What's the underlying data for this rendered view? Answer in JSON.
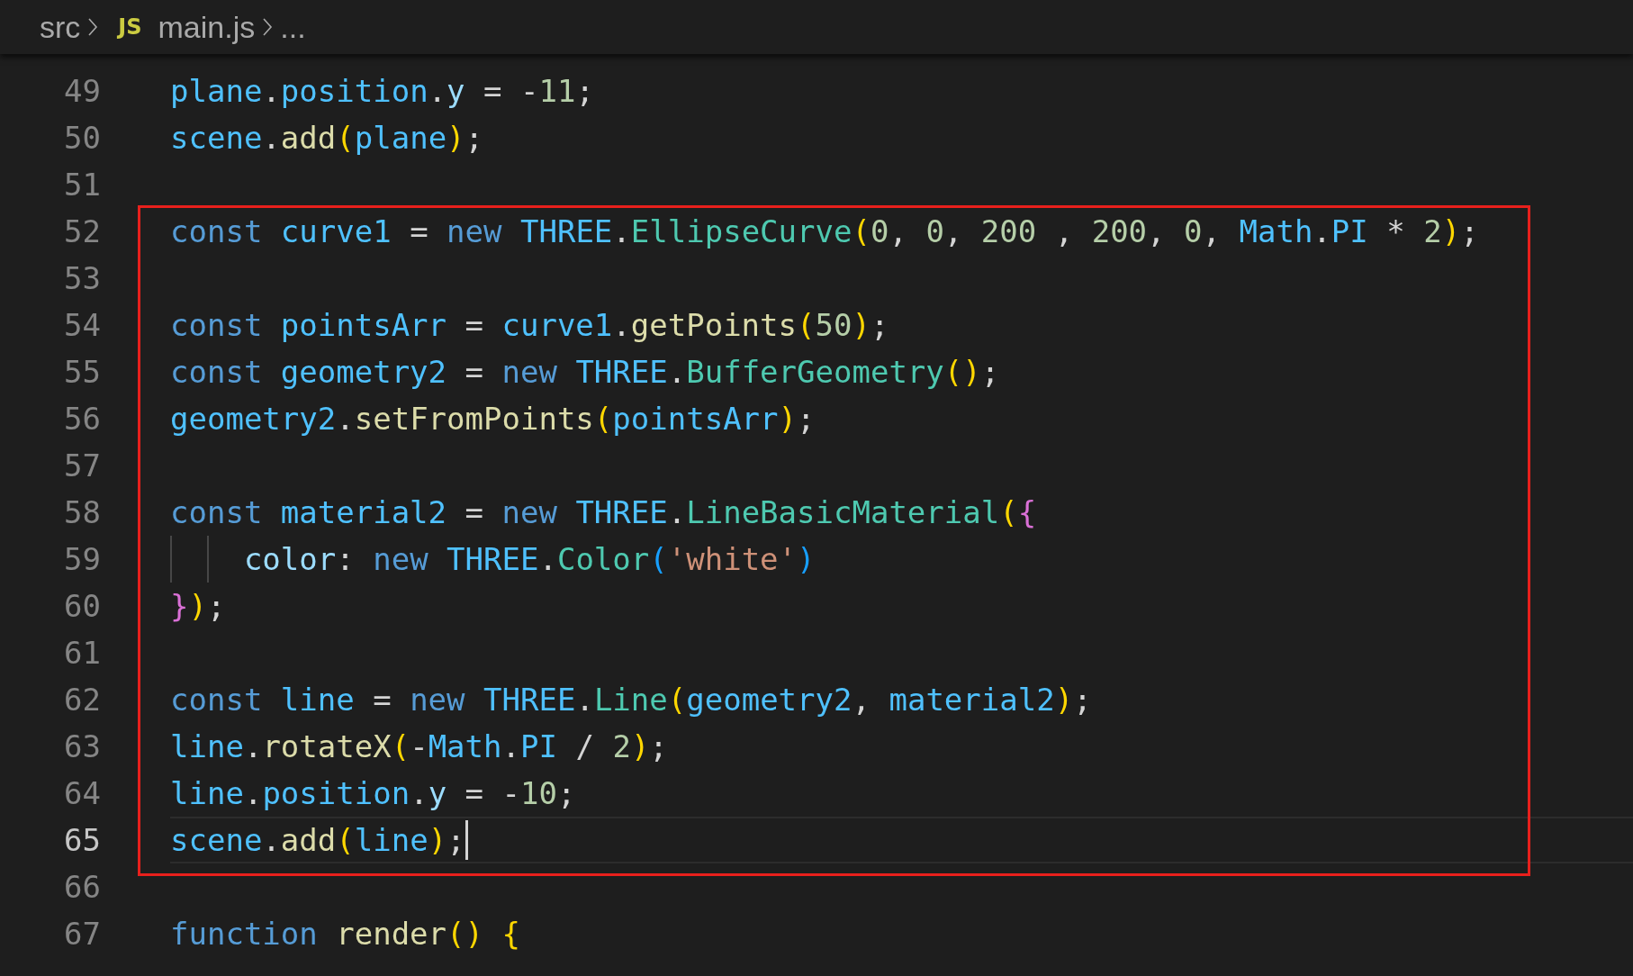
{
  "breadcrumb": {
    "folder": "src",
    "file_icon": "JS",
    "file": "main.js",
    "more": "..."
  },
  "code": {
    "blocks": [
      {
        "boxed": false,
        "lines": [
          {
            "number": "49",
            "current": false,
            "indented": false,
            "tokens": [
              {
                "t": "plane",
                "kind": "var"
              },
              {
                "t": ".",
                "kind": "punc"
              },
              {
                "t": "position",
                "kind": "var"
              },
              {
                "t": ".",
                "kind": "punc"
              },
              {
                "t": "y",
                "kind": "prop"
              },
              {
                "t": " = -",
                "kind": "punc"
              },
              {
                "t": "11",
                "kind": "num"
              },
              {
                "t": ";",
                "kind": "punc"
              }
            ]
          },
          {
            "number": "50",
            "current": false,
            "indented": false,
            "tokens": [
              {
                "t": "scene",
                "kind": "var"
              },
              {
                "t": ".",
                "kind": "punc"
              },
              {
                "t": "add",
                "kind": "fn"
              },
              {
                "t": "(",
                "kind": "br1"
              },
              {
                "t": "plane",
                "kind": "var"
              },
              {
                "t": ")",
                "kind": "br1"
              },
              {
                "t": ";",
                "kind": "punc"
              }
            ]
          },
          {
            "number": "51",
            "current": false,
            "indented": false
          }
        ]
      },
      {
        "boxed": true,
        "lines": [
          {
            "number": "52",
            "current": false,
            "indented": false,
            "tokens": [
              {
                "t": "const ",
                "kind": "kw"
              },
              {
                "t": "curve1",
                "kind": "var"
              },
              {
                "t": " = ",
                "kind": "punc"
              },
              {
                "t": "new ",
                "kind": "kw"
              },
              {
                "t": "THREE",
                "kind": "var"
              },
              {
                "t": ".",
                "kind": "punc"
              },
              {
                "t": "EllipseCurve",
                "kind": "cls"
              },
              {
                "t": "(",
                "kind": "br1"
              },
              {
                "t": "0",
                "kind": "num"
              },
              {
                "t": ", ",
                "kind": "punc"
              },
              {
                "t": "0",
                "kind": "num"
              },
              {
                "t": ", ",
                "kind": "punc"
              },
              {
                "t": "200",
                "kind": "num"
              },
              {
                "t": " , ",
                "kind": "punc"
              },
              {
                "t": "200",
                "kind": "num"
              },
              {
                "t": ", ",
                "kind": "punc"
              },
              {
                "t": "0",
                "kind": "num"
              },
              {
                "t": ", ",
                "kind": "punc"
              },
              {
                "t": "Math",
                "kind": "var"
              },
              {
                "t": ".",
                "kind": "punc"
              },
              {
                "t": "PI",
                "kind": "var"
              },
              {
                "t": " * ",
                "kind": "punc"
              },
              {
                "t": "2",
                "kind": "num"
              },
              {
                "t": ")",
                "kind": "br1"
              },
              {
                "t": ";",
                "kind": "punc"
              }
            ]
          },
          {
            "number": "53",
            "current": false,
            "indented": false
          },
          {
            "number": "54",
            "current": false,
            "indented": false,
            "tokens": [
              {
                "t": "const ",
                "kind": "kw"
              },
              {
                "t": "pointsArr",
                "kind": "var"
              },
              {
                "t": " = ",
                "kind": "punc"
              },
              {
                "t": "curve1",
                "kind": "var"
              },
              {
                "t": ".",
                "kind": "punc"
              },
              {
                "t": "getPoints",
                "kind": "fn"
              },
              {
                "t": "(",
                "kind": "br1"
              },
              {
                "t": "50",
                "kind": "num"
              },
              {
                "t": ")",
                "kind": "br1"
              },
              {
                "t": ";",
                "kind": "punc"
              }
            ]
          },
          {
            "number": "55",
            "current": false,
            "indented": false,
            "tokens": [
              {
                "t": "const ",
                "kind": "kw"
              },
              {
                "t": "geometry2",
                "kind": "var"
              },
              {
                "t": " = ",
                "kind": "punc"
              },
              {
                "t": "new ",
                "kind": "kw"
              },
              {
                "t": "THREE",
                "kind": "var"
              },
              {
                "t": ".",
                "kind": "punc"
              },
              {
                "t": "BufferGeometry",
                "kind": "cls"
              },
              {
                "t": "()",
                "kind": "br1"
              },
              {
                "t": ";",
                "kind": "punc"
              }
            ]
          },
          {
            "number": "56",
            "current": false,
            "indented": false,
            "tokens": [
              {
                "t": "geometry2",
                "kind": "var"
              },
              {
                "t": ".",
                "kind": "punc"
              },
              {
                "t": "setFromPoints",
                "kind": "fn"
              },
              {
                "t": "(",
                "kind": "br1"
              },
              {
                "t": "pointsArr",
                "kind": "var"
              },
              {
                "t": ")",
                "kind": "br1"
              },
              {
                "t": ";",
                "kind": "punc"
              }
            ]
          },
          {
            "number": "57",
            "current": false,
            "indented": false
          },
          {
            "number": "58",
            "current": false,
            "indented": false,
            "tokens": [
              {
                "t": "const ",
                "kind": "kw"
              },
              {
                "t": "material2",
                "kind": "var"
              },
              {
                "t": " = ",
                "kind": "punc"
              },
              {
                "t": "new ",
                "kind": "kw"
              },
              {
                "t": "THREE",
                "kind": "var"
              },
              {
                "t": ".",
                "kind": "punc"
              },
              {
                "t": "LineBasicMaterial",
                "kind": "cls"
              },
              {
                "t": "(",
                "kind": "br1"
              },
              {
                "t": "{",
                "kind": "br2"
              }
            ]
          },
          {
            "number": "59",
            "current": false,
            "indented": true,
            "tokens": [
              {
                "t": "color",
                "kind": "prop"
              },
              {
                "t": ": ",
                "kind": "punc"
              },
              {
                "t": "new ",
                "kind": "kw"
              },
              {
                "t": "THREE",
                "kind": "var"
              },
              {
                "t": ".",
                "kind": "punc"
              },
              {
                "t": "Color",
                "kind": "cls"
              },
              {
                "t": "(",
                "kind": "br3"
              },
              {
                "t": "'white'",
                "kind": "str"
              },
              {
                "t": ")",
                "kind": "br3"
              }
            ]
          },
          {
            "number": "60",
            "current": false,
            "indented": false,
            "tokens": [
              {
                "t": "}",
                "kind": "br2"
              },
              {
                "t": ")",
                "kind": "br1"
              },
              {
                "t": ";",
                "kind": "punc"
              }
            ]
          },
          {
            "number": "61",
            "current": false,
            "indented": false
          },
          {
            "number": "62",
            "current": false,
            "indented": false,
            "tokens": [
              {
                "t": "const ",
                "kind": "kw"
              },
              {
                "t": "line",
                "kind": "var"
              },
              {
                "t": " = ",
                "kind": "punc"
              },
              {
                "t": "new ",
                "kind": "kw"
              },
              {
                "t": "THREE",
                "kind": "var"
              },
              {
                "t": ".",
                "kind": "punc"
              },
              {
                "t": "Line",
                "kind": "cls"
              },
              {
                "t": "(",
                "kind": "br1"
              },
              {
                "t": "geometry2",
                "kind": "var"
              },
              {
                "t": ", ",
                "kind": "punc"
              },
              {
                "t": "material2",
                "kind": "var"
              },
              {
                "t": ")",
                "kind": "br1"
              },
              {
                "t": ";",
                "kind": "punc"
              }
            ]
          },
          {
            "number": "63",
            "current": false,
            "indented": false,
            "tokens": [
              {
                "t": "line",
                "kind": "var"
              },
              {
                "t": ".",
                "kind": "punc"
              },
              {
                "t": "rotateX",
                "kind": "fn"
              },
              {
                "t": "(",
                "kind": "br1"
              },
              {
                "t": "-",
                "kind": "punc"
              },
              {
                "t": "Math",
                "kind": "var"
              },
              {
                "t": ".",
                "kind": "punc"
              },
              {
                "t": "PI",
                "kind": "var"
              },
              {
                "t": " / ",
                "kind": "punc"
              },
              {
                "t": "2",
                "kind": "num"
              },
              {
                "t": ")",
                "kind": "br1"
              },
              {
                "t": ";",
                "kind": "punc"
              }
            ]
          },
          {
            "number": "64",
            "current": false,
            "indented": false,
            "tokens": [
              {
                "t": "line",
                "kind": "var"
              },
              {
                "t": ".",
                "kind": "punc"
              },
              {
                "t": "position",
                "kind": "var"
              },
              {
                "t": ".",
                "kind": "punc"
              },
              {
                "t": "y",
                "kind": "prop"
              },
              {
                "t": " = -",
                "kind": "punc"
              },
              {
                "t": "10",
                "kind": "num"
              },
              {
                "t": ";",
                "kind": "punc"
              }
            ]
          },
          {
            "number": "65",
            "current": true,
            "indented": false,
            "tokens": [
              {
                "t": "scene",
                "kind": "var"
              },
              {
                "t": ".",
                "kind": "punc"
              },
              {
                "t": "add",
                "kind": "fn"
              },
              {
                "t": "(",
                "kind": "br1"
              },
              {
                "t": "line",
                "kind": "var"
              },
              {
                "t": ")",
                "kind": "br1"
              },
              {
                "t": ";",
                "kind": "punc"
              }
            ]
          }
        ]
      },
      {
        "boxed": false,
        "lines": [
          {
            "number": "66",
            "current": false,
            "indented": false
          },
          {
            "number": "67",
            "current": false,
            "indented": false,
            "tokens": [
              {
                "t": "function ",
                "kind": "kw"
              },
              {
                "t": "render",
                "kind": "fn"
              },
              {
                "t": "() {",
                "kind": "br1"
              }
            ]
          }
        ]
      }
    ]
  }
}
